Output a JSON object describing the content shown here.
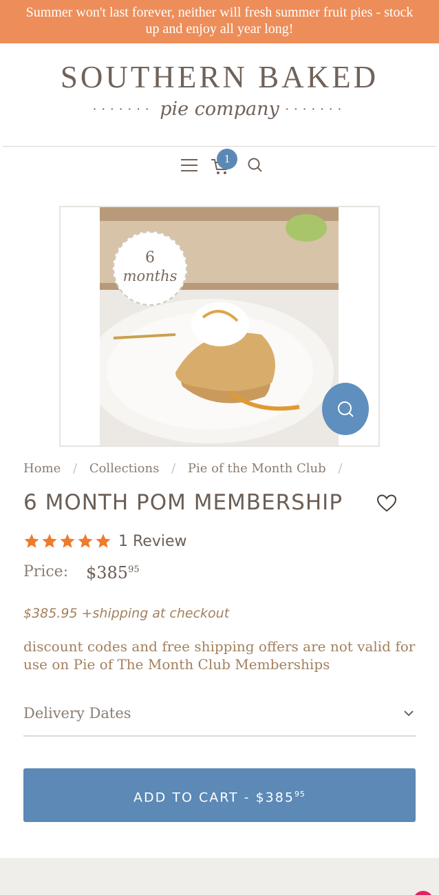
{
  "banner": {
    "text": "Summer won't last forever, neither will fresh summer fruit pies - stock up and enjoy all year long!"
  },
  "logo": {
    "main": "SOUTHERN BAKED",
    "sub": "pie company",
    "dots": "·······"
  },
  "nav": {
    "cart_count": "1"
  },
  "product_image": {
    "badge_number": "6",
    "badge_unit": "months"
  },
  "breadcrumb": {
    "items": [
      "Home",
      "Collections",
      "Pie of the Month Club"
    ],
    "separator": "/"
  },
  "product": {
    "title": "6 MONTH POM MEMBERSHIP",
    "rating": 5,
    "review_text": "1 Review",
    "price_label": "Price:",
    "price_dollars": "$385",
    "price_cents": "95",
    "shipping_note": "$385.95 +shipping at checkout",
    "discount_note": "discount codes and free shipping offers are not valid for use on Pie of The Month Club Memberships"
  },
  "delivery": {
    "label": "Delivery Dates"
  },
  "add_to_cart": {
    "label": "ADD TO CART - $385",
    "cents": "95"
  },
  "colors": {
    "banner": "#ed8e5a",
    "accent_blue": "#5c89b6",
    "star": "#ee7b2c",
    "text": "#6b5e55"
  }
}
